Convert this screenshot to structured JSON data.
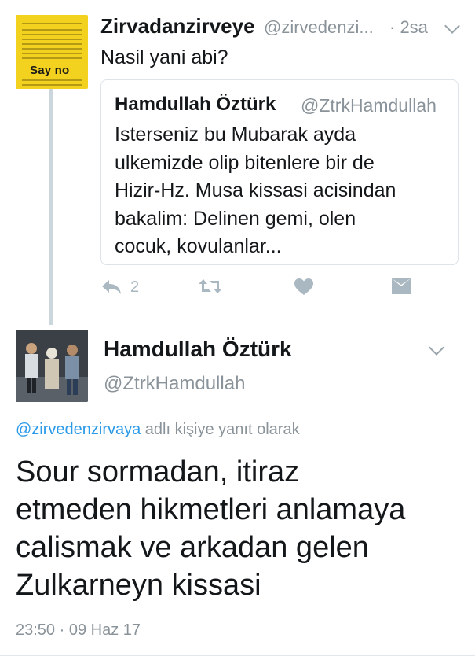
{
  "reply_context_tweet": {
    "avatar_text": "Say no",
    "author_name": "Zirvadanzirveye",
    "author_handle": "@zirvedenzi...",
    "time": "· 2sa",
    "text": "Nasil yani abi?",
    "quoted_tweet": {
      "author_name": "Hamdullah Öztürk",
      "author_handle": "@ZtrkHamdullah",
      "text_lines": [
        "Isterseniz bu Mubarak ayda",
        "ulkemizde olip bitenlere bir de",
        "Hizir-Hz. Musa kissasi acisindan",
        "bakalim: Delinen gemi, olen",
        "cocuk, kovulanlar..."
      ]
    },
    "actions": {
      "reply_icon": "reply-icon",
      "reply_count": "2",
      "retweet_icon": "retweet-icon",
      "like_icon": "heart-icon",
      "message_icon": "envelope-icon"
    }
  },
  "main_tweet": {
    "author_name": "Hamdullah Öztürk",
    "author_handle": "@ZtrkHamdullah",
    "reply_to_mention": "@zirvedenzirvaya",
    "reply_to_suffix": " adlı kişiye yanıt olarak",
    "text_lines": [
      "Sour sormadan, itiraz",
      "etmeden hikmetleri anlamaya",
      "calismak ve arkadan gelen",
      "Zulkarneyn kissasi"
    ],
    "timestamp": "23:50 · 09 Haz 17"
  },
  "colors": {
    "link": "#2b9ae8",
    "muted": "#8a9399",
    "icon": "#aab8c2",
    "avatar_yellow": "#f3d11f"
  }
}
